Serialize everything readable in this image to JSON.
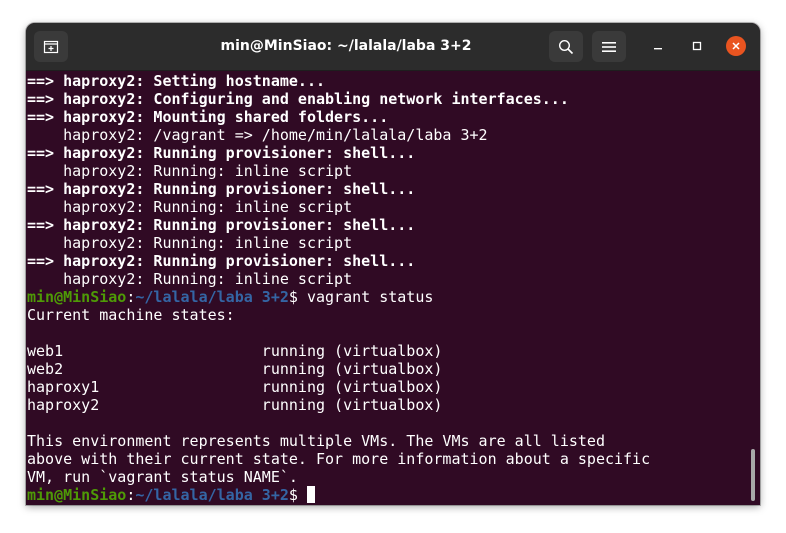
{
  "window": {
    "title": "min@MinSiao: ~/lalala/laba 3+2"
  },
  "terminal": {
    "lines": [
      {
        "prefix": "==> ",
        "text": "haproxy2: Setting hostname..."
      },
      {
        "prefix": "==> ",
        "text": "haproxy2: Configuring and enabling network interfaces..."
      },
      {
        "prefix": "==> ",
        "text": "haproxy2: Mounting shared folders..."
      },
      {
        "prefix": "",
        "text": "    haproxy2: /vagrant => /home/min/lalala/laba 3+2"
      },
      {
        "prefix": "==> ",
        "text": "haproxy2: Running provisioner: shell..."
      },
      {
        "prefix": "",
        "text": "    haproxy2: Running: inline script"
      },
      {
        "prefix": "==> ",
        "text": "haproxy2: Running provisioner: shell..."
      },
      {
        "prefix": "",
        "text": "    haproxy2: Running: inline script"
      },
      {
        "prefix": "==> ",
        "text": "haproxy2: Running provisioner: shell..."
      },
      {
        "prefix": "",
        "text": "    haproxy2: Running: inline script"
      },
      {
        "prefix": "==> ",
        "text": "haproxy2: Running provisioner: shell..."
      },
      {
        "prefix": "",
        "text": "    haproxy2: Running: inline script"
      }
    ],
    "prompt_user": "min@MinSiao",
    "prompt_sep": ":",
    "prompt_path": "~/lalala/laba 3+2",
    "prompt_symbol": "$ ",
    "command": "vagrant status",
    "output": [
      "Current machine states:",
      "",
      "web1                      running (virtualbox)",
      "web2                      running (virtualbox)",
      "haproxy1                  running (virtualbox)",
      "haproxy2                  running (virtualbox)",
      "",
      "This environment represents multiple VMs. The VMs are all listed",
      "above with their current state. For more information about a specific",
      "VM, run `vagrant status NAME`."
    ]
  },
  "icons": {
    "new_tab": "new-tab-icon",
    "search": "search-icon",
    "menu": "hamburger-menu-icon",
    "minimize": "minimize-icon",
    "maximize": "maximize-icon",
    "close": "close-icon"
  },
  "colors": {
    "terminal_bg": "#300a24",
    "prompt_user": "#4e9a06",
    "prompt_path": "#3465a4",
    "close_button": "#e95420"
  }
}
